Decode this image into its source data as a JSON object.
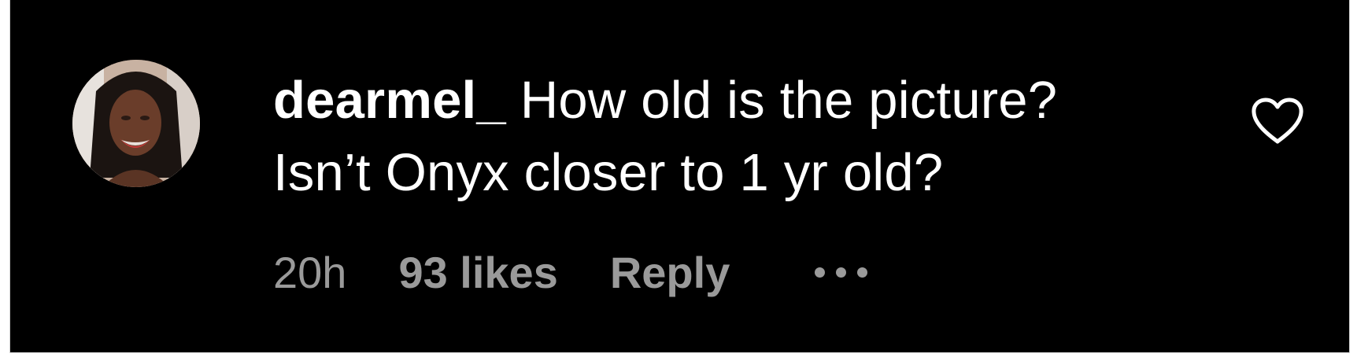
{
  "comment": {
    "username": "dearmel_",
    "text_line1": "How old is the picture?",
    "text_line2": "Isn’t Onyx closer to 1 yr old?",
    "timestamp": "20h",
    "likes_label": "93 likes",
    "reply_label": "Reply"
  },
  "icons": {
    "like": "heart-outline-icon",
    "more": "more-options-icon"
  },
  "colors": {
    "background": "#000000",
    "text_primary": "#ffffff",
    "text_secondary": "#9a9a9a"
  }
}
